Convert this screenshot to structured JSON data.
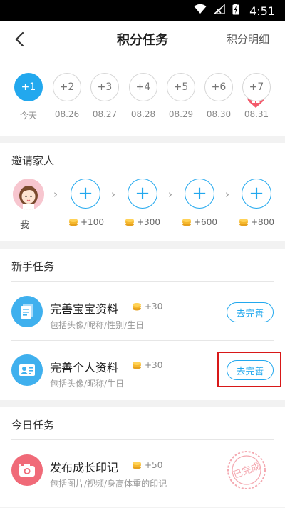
{
  "status_bar": {
    "time": "4:51"
  },
  "header": {
    "title": "积分任务",
    "link": "积分明细"
  },
  "checkin": {
    "days": [
      {
        "label": "+1",
        "date": "今天",
        "active": true
      },
      {
        "label": "+2",
        "date": "08.26",
        "active": false
      },
      {
        "label": "+3",
        "date": "08.27",
        "active": false
      },
      {
        "label": "+4",
        "date": "08.28",
        "active": false
      },
      {
        "label": "+5",
        "date": "08.29",
        "active": false
      },
      {
        "label": "+6",
        "date": "08.30",
        "active": false
      },
      {
        "label": "+7",
        "date": "08.31",
        "active": false
      }
    ]
  },
  "invite": {
    "title": "邀请家人",
    "me_label": "我",
    "slots": [
      {
        "plus": "+",
        "reward": "+100"
      },
      {
        "plus": "+",
        "reward": "+300"
      },
      {
        "plus": "+",
        "reward": "+600"
      },
      {
        "plus": "+",
        "reward": "+800"
      }
    ]
  },
  "newbie": {
    "title": "新手任务",
    "tasks": [
      {
        "title": "完善宝宝资料",
        "reward": "+30",
        "subtitle": "包括头像/昵称/性别/生日",
        "button": "去完善"
      },
      {
        "title": "完善个人资料",
        "reward": "+30",
        "subtitle": "包括头像/昵称/生日",
        "button": "去完善"
      }
    ]
  },
  "daily": {
    "title": "今日任务",
    "tasks": [
      {
        "title": "发布成长印记",
        "reward": "+50",
        "subtitle": "包括图片/视频/身高体重的印记",
        "stamp": "已完成"
      }
    ]
  },
  "colors": {
    "accent": "#22a8ee",
    "highlight": "#d81818",
    "coin": "#f5b82e"
  }
}
